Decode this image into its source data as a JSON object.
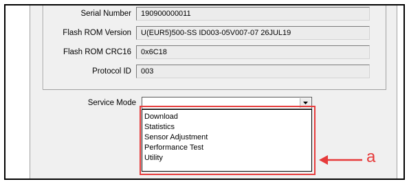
{
  "fields": [
    {
      "label": "Serial Number",
      "value": "190900000011"
    },
    {
      "label": "Flash ROM Version",
      "value": "U(EUR5)500-SS ID003-05V007-07 26JUL19"
    },
    {
      "label": "Flash ROM CRC16",
      "value": "0x6C18"
    },
    {
      "label": "Protocol ID",
      "value": "003"
    }
  ],
  "service_mode": {
    "label": "Service Mode",
    "selected": "",
    "options": [
      "Download",
      "Statistics",
      "Sensor Adjustment",
      "Performance Test",
      "Utility"
    ]
  },
  "annotation": {
    "callout_letter": "a",
    "color": "#e63a3a"
  }
}
